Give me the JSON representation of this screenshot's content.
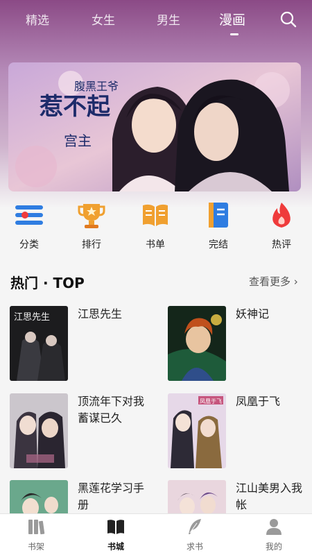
{
  "top_tabs": [
    {
      "label": "精选",
      "active": false
    },
    {
      "label": "女生",
      "active": false
    },
    {
      "label": "男生",
      "active": false
    },
    {
      "label": "漫画",
      "active": true
    }
  ],
  "banner": {
    "art_text": "腹黑王爷惹不起 宫主"
  },
  "categories": [
    {
      "label": "分类",
      "icon": "list-icon"
    },
    {
      "label": "排行",
      "icon": "trophy-icon"
    },
    {
      "label": "书单",
      "icon": "open-book-icon"
    },
    {
      "label": "完结",
      "icon": "closed-book-icon"
    },
    {
      "label": "热评",
      "icon": "flame-icon"
    }
  ],
  "section": {
    "title": "热门 · TOP",
    "more": "查看更多 ›"
  },
  "books": [
    {
      "title": "江思先生",
      "cover_text": "江思先生"
    },
    {
      "title": "妖神记"
    },
    {
      "title": "顶流年下对我蓄谋已久"
    },
    {
      "title": "凤凰于飞",
      "cover_text": "凤凰于飞"
    },
    {
      "title": "黑莲花学习手册"
    },
    {
      "title": "江山美男入我帐"
    }
  ],
  "bottom_nav": [
    {
      "label": "书架",
      "icon": "bookshelf-icon",
      "active": false
    },
    {
      "label": "书城",
      "icon": "book-store-icon",
      "active": true
    },
    {
      "label": "求书",
      "icon": "quill-icon",
      "active": false
    },
    {
      "label": "我的",
      "icon": "user-icon",
      "active": false
    }
  ],
  "colors": {
    "header_top": "#8b4a86",
    "icon_blue": "#2f7de1",
    "icon_orange": "#f0a030",
    "icon_red": "#ef3b3b",
    "background": "#f5f5f5"
  }
}
